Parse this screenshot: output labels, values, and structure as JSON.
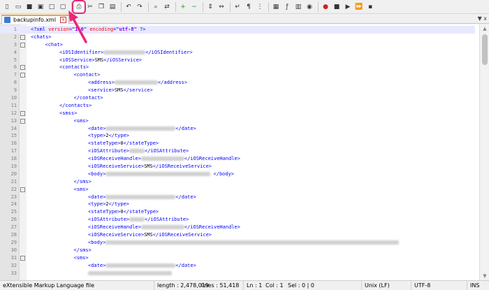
{
  "toolbar": {
    "icons": [
      "new-file-icon",
      "open-file-icon",
      "save-icon",
      "save-all-icon",
      "close-icon",
      "close-all-icon",
      "print-icon",
      "cut-icon",
      "copy-icon",
      "paste-icon",
      "undo-icon",
      "redo-icon",
      "find-icon",
      "replace-icon",
      "zoom-in-icon",
      "zoom-out-icon",
      "sync-vertical-icon",
      "sync-horizontal-icon",
      "word-wrap-icon",
      "show-all-characters-icon",
      "indent-guide-icon",
      "doc-map-icon",
      "function-list-icon",
      "folder-workspace-icon",
      "monitoring-icon",
      "record-macro-icon",
      "stop-macro-icon",
      "play-macro-icon",
      "run-macro-multiple-icon",
      "save-macro-icon"
    ]
  },
  "tab": {
    "label": "backupinfo.xml",
    "close": "x"
  },
  "tabbar_end": "▼ x",
  "editor": {
    "lines": [
      {
        "n": "1",
        "fold": "",
        "indent": 0,
        "parts": [
          [
            "pi",
            "<?xml version=\"1.0\" encoding=\"utf-8\" ?>"
          ]
        ]
      },
      {
        "n": "2",
        "fold": "-",
        "indent": 0,
        "parts": [
          [
            "tag",
            "<chats>"
          ]
        ]
      },
      {
        "n": "3",
        "fold": "-",
        "indent": 1,
        "parts": [
          [
            "tag",
            "<chat>"
          ]
        ]
      },
      {
        "n": "4",
        "fold": "",
        "indent": 2,
        "parts": [
          [
            "tag",
            "<iOSIdentifier>"
          ],
          [
            "blur",
            "60"
          ],
          [
            "tag",
            "</iOSIdentifier>"
          ]
        ]
      },
      {
        "n": "5",
        "fold": "",
        "indent": 2,
        "parts": [
          [
            "tag",
            "<iOSService>"
          ],
          [
            "text",
            "SMS"
          ],
          [
            "tag",
            "</iOSService>"
          ]
        ]
      },
      {
        "n": "6",
        "fold": "-",
        "indent": 2,
        "parts": [
          [
            "tag",
            "<contacts>"
          ]
        ]
      },
      {
        "n": "7",
        "fold": "-",
        "indent": 3,
        "parts": [
          [
            "tag",
            "<contact>"
          ]
        ]
      },
      {
        "n": "8",
        "fold": "",
        "indent": 4,
        "parts": [
          [
            "tag",
            "<address>"
          ],
          [
            "blur",
            "62"
          ],
          [
            "tag",
            "</address>"
          ]
        ]
      },
      {
        "n": "9",
        "fold": "",
        "indent": 4,
        "parts": [
          [
            "tag",
            "<service>"
          ],
          [
            "text",
            "SMS"
          ],
          [
            "tag",
            "</service>"
          ]
        ]
      },
      {
        "n": "10",
        "fold": "",
        "indent": 3,
        "parts": [
          [
            "tag",
            "</contact>"
          ]
        ]
      },
      {
        "n": "11",
        "fold": "",
        "indent": 2,
        "parts": [
          [
            "tag",
            "</contacts>"
          ]
        ]
      },
      {
        "n": "12",
        "fold": "-",
        "indent": 2,
        "parts": [
          [
            "tag",
            "<smss>"
          ]
        ]
      },
      {
        "n": "13",
        "fold": "-",
        "indent": 3,
        "parts": [
          [
            "tag",
            "<sms>"
          ]
        ]
      },
      {
        "n": "14",
        "fold": "",
        "indent": 4,
        "parts": [
          [
            "tag",
            "<date>"
          ],
          [
            "blur",
            "100"
          ],
          [
            "tag",
            "</date>"
          ]
        ]
      },
      {
        "n": "15",
        "fold": "",
        "indent": 4,
        "parts": [
          [
            "tag",
            "<type>"
          ],
          [
            "text",
            "2"
          ],
          [
            "tag",
            "</type>"
          ]
        ]
      },
      {
        "n": "16",
        "fold": "",
        "indent": 4,
        "parts": [
          [
            "tag",
            "<stateType>"
          ],
          [
            "text",
            "0"
          ],
          [
            "tag",
            "</stateType>"
          ]
        ]
      },
      {
        "n": "17",
        "fold": "",
        "indent": 4,
        "parts": [
          [
            "tag",
            "<iOSAttribute>"
          ],
          [
            "blur",
            "22"
          ],
          [
            "tag",
            "</iOSAttribute>"
          ]
        ]
      },
      {
        "n": "18",
        "fold": "",
        "indent": 4,
        "parts": [
          [
            "tag",
            "<iOSReceiveHandle>"
          ],
          [
            "blur",
            "62"
          ],
          [
            "tag",
            "</iOSReceiveHandle>"
          ]
        ]
      },
      {
        "n": "19",
        "fold": "",
        "indent": 4,
        "parts": [
          [
            "tag",
            "<iOSReceiveService>"
          ],
          [
            "text",
            "SMS"
          ],
          [
            "tag",
            "</iOSReceiveService>"
          ]
        ]
      },
      {
        "n": "20",
        "fold": "",
        "indent": 4,
        "parts": [
          [
            "tag",
            "<body>"
          ],
          [
            "blur",
            "150"
          ],
          [
            "tag",
            " </body>"
          ]
        ]
      },
      {
        "n": "21",
        "fold": "",
        "indent": 3,
        "parts": [
          [
            "tag",
            "</sms>"
          ]
        ]
      },
      {
        "n": "22",
        "fold": "-",
        "indent": 3,
        "parts": [
          [
            "tag",
            "<sms>"
          ]
        ]
      },
      {
        "n": "23",
        "fold": "",
        "indent": 4,
        "parts": [
          [
            "tag",
            "<date>"
          ],
          [
            "blur",
            "100"
          ],
          [
            "tag",
            "</date>"
          ]
        ]
      },
      {
        "n": "24",
        "fold": "",
        "indent": 4,
        "parts": [
          [
            "tag",
            "<type>"
          ],
          [
            "text",
            "2"
          ],
          [
            "tag",
            "</type>"
          ]
        ]
      },
      {
        "n": "25",
        "fold": "",
        "indent": 4,
        "parts": [
          [
            "tag",
            "<stateType>"
          ],
          [
            "text",
            "0"
          ],
          [
            "tag",
            "</stateType>"
          ]
        ]
      },
      {
        "n": "26",
        "fold": "",
        "indent": 4,
        "parts": [
          [
            "tag",
            "<iOSAttribute>"
          ],
          [
            "blur",
            "22"
          ],
          [
            "tag",
            "</iOSAttribute>"
          ]
        ]
      },
      {
        "n": "27",
        "fold": "",
        "indent": 4,
        "parts": [
          [
            "tag",
            "<iOSReceiveHandle>"
          ],
          [
            "blur",
            "62"
          ],
          [
            "tag",
            "</iOSReceiveHandle>"
          ]
        ]
      },
      {
        "n": "28",
        "fold": "",
        "indent": 4,
        "parts": [
          [
            "tag",
            "<iOSReceiveService>"
          ],
          [
            "text",
            "SMS"
          ],
          [
            "tag",
            "</iOSReceiveService>"
          ]
        ]
      },
      {
        "n": "29",
        "fold": "",
        "indent": 4,
        "parts": [
          [
            "tag",
            "<body>"
          ],
          [
            "blur",
            "420"
          ]
        ]
      },
      {
        "n": "30",
        "fold": "",
        "indent": 3,
        "parts": [
          [
            "tag",
            "</sms>"
          ]
        ]
      },
      {
        "n": "31",
        "fold": "-",
        "indent": 3,
        "parts": [
          [
            "tag",
            "<sms>"
          ]
        ]
      },
      {
        "n": "32",
        "fold": "",
        "indent": 4,
        "parts": [
          [
            "tag",
            "<date>"
          ],
          [
            "blur",
            "100"
          ],
          [
            "tag",
            "</date>"
          ]
        ]
      },
      {
        "n": "33",
        "fold": "",
        "indent": 4,
        "parts": [
          [
            "blur",
            "120"
          ]
        ]
      }
    ]
  },
  "statusbar": {
    "filetype": "eXtensible Markup Language file",
    "length": "length : 2,478,019",
    "lines": "lines : 51,418",
    "ln": "Ln : 1",
    "col": "Col : 1",
    "sel": "Sel : 0 | 0",
    "eol": "Unix (LF)",
    "encoding": "UTF-8",
    "mode": "INS"
  },
  "colors": {
    "highlight": "#e8287a",
    "tab_accent": "#f5a623",
    "tag": "#0000ff",
    "pi": "#ff0000"
  }
}
